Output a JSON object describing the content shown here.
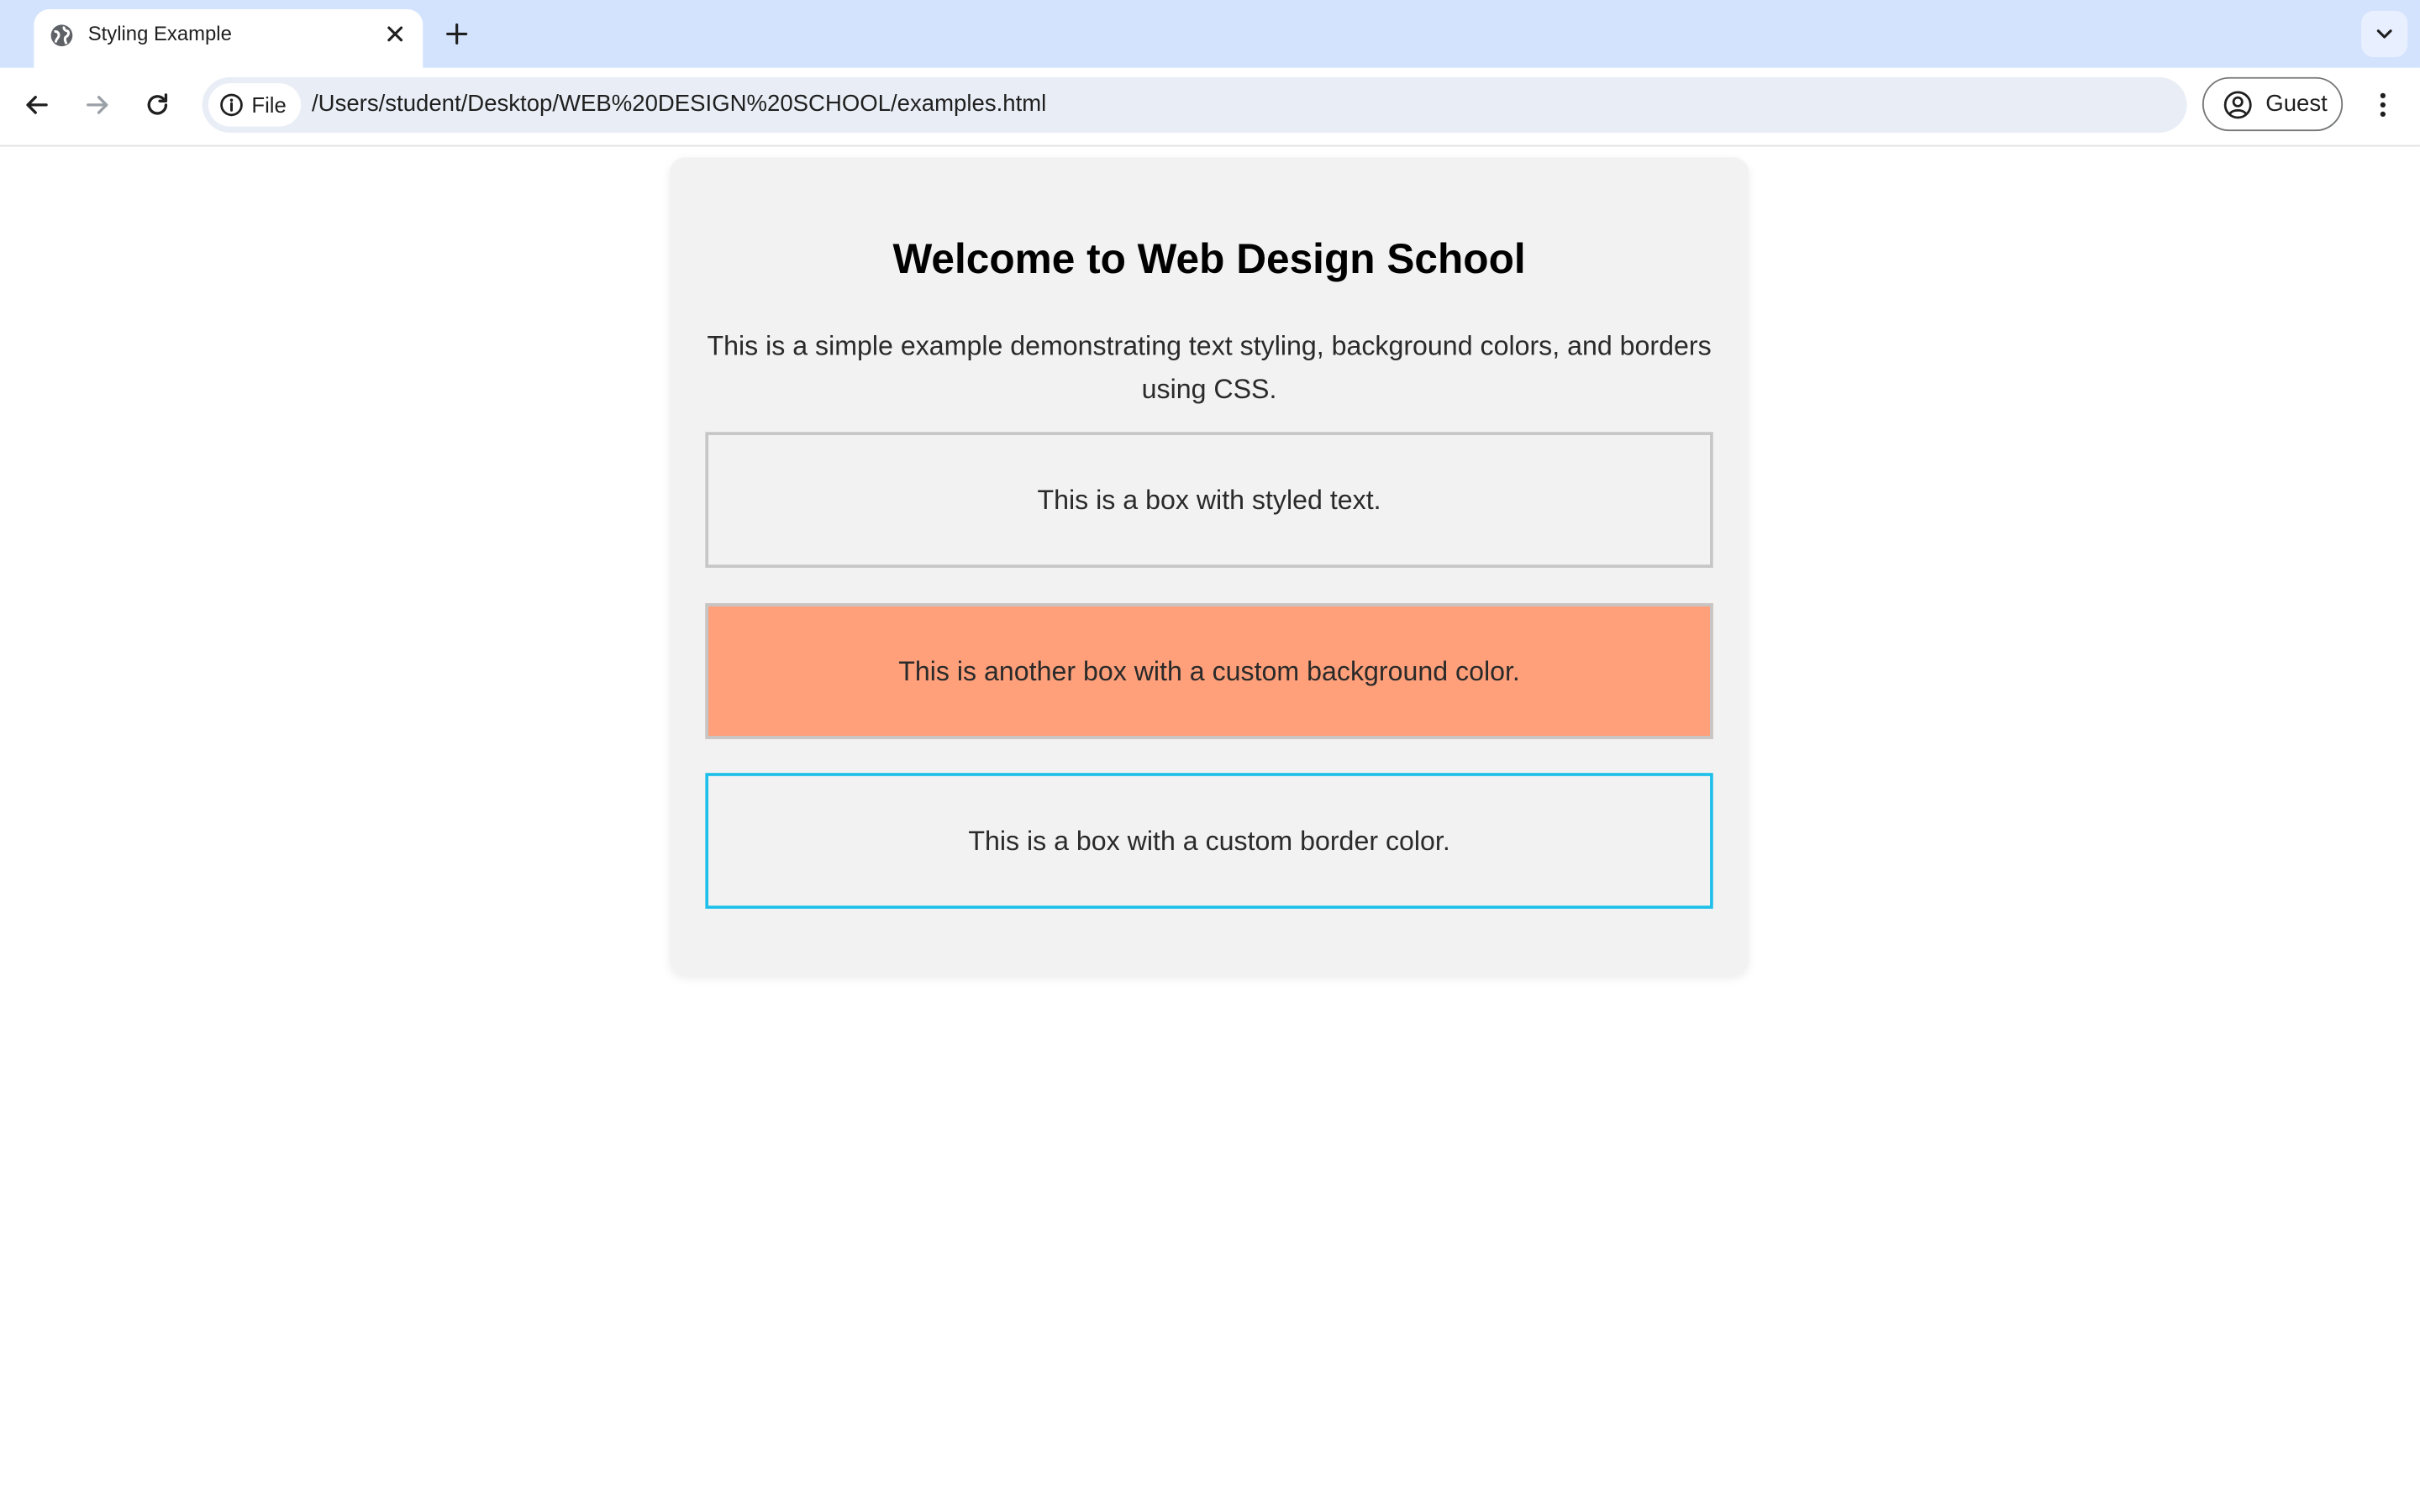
{
  "browser": {
    "tab": {
      "title": "Styling Example",
      "favicon": "globe-icon"
    },
    "address_bar": {
      "site_chip": "File",
      "url": "/Users/student/Desktop/WEB%20DESIGN%20SCHOOL/examples.html"
    },
    "profile": {
      "label": "Guest"
    }
  },
  "page": {
    "heading": "Welcome to Web Design School",
    "intro": "This is a simple example demonstrating text styling, background colors, and borders using CSS.",
    "boxes": [
      {
        "text": "This is a box with styled text.",
        "background": "#f2f2f2",
        "border_color": "#c6c6c6"
      },
      {
        "text": "This is another box with a custom background color.",
        "background": "#ffa07a",
        "border_color": "#c6c6c6"
      },
      {
        "text": "This is a box with a custom border color.",
        "background": "#f2f2f2",
        "border_color": "#1ec0ea"
      }
    ]
  },
  "colors": {
    "tabstrip_bg": "#d3e3fd",
    "omnibox_bg": "#e9eef6",
    "container_bg": "#f2f2f2"
  }
}
